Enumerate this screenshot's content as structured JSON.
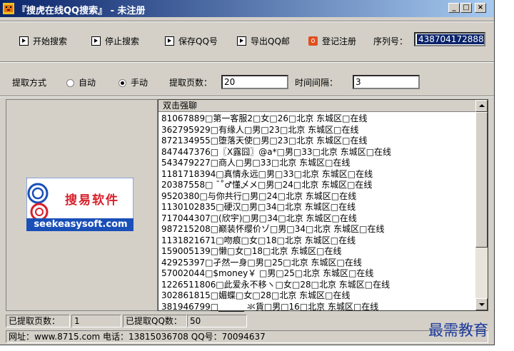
{
  "window": {
    "title": "『搜虎在线QQ搜索』 - 未注册",
    "controls": {
      "minimize": "_",
      "maximize": "□",
      "close": "×"
    }
  },
  "toolbar": {
    "start_search": "开始搜索",
    "stop_search": "停止搜索",
    "save_qq": "保存QQ号",
    "export_qq_mail": "导出QQ邮",
    "register": "登记注册",
    "serial_label": "序列号：",
    "serial_value": "438704172888"
  },
  "options": {
    "mode_label": "提取方式",
    "mode_auto": "自动",
    "mode_manual": "手动",
    "mode_selected": "manual",
    "pages_label": "提取页数：",
    "pages_value": "20",
    "interval_label": "时间间隔：",
    "interval_value": "3"
  },
  "logo": {
    "brand_cn": "搜易软件",
    "brand_url": "seekeasysoft.com"
  },
  "results": {
    "header": "双击强聊",
    "rows": [
      "81067889□第一客服2□女□26□北京 东城区□在线",
      "362795929□有缘人□男□23□北京 东城区□在线",
      "872134955□堕落天使□男□23□北京 东城区□在线",
      "847447376□〖Ⅹ露囧〗@a*□男□33□北京 东城区□在线",
      "543479227□商人□男□33□北京 东城区□在线",
      "1181718394□真情永远□男□33□北京 东城区□在线",
      "20387558□ ˉ˚♂懂乄メ□男□24□北京 东城区□在线",
      "9520380□与你共行□男□24□北京 东城区□在线",
      "1130102835□硬汉□男□34□北京 东城区□在线",
      "717044307□(欣宇)□男□34□北京 东城区□在线",
      "987215208□巅装怀缨价ゾ□男□34□北京 东城区□在线",
      "1131821671□吻痕□女□18□北京 东城区□在线",
      "159005139□懒□女□18□北京 东城区□在线",
      "42925397□孑然一身□男□25□北京 东城区□在线",
      "57002044□$money￥ □男□25□北京 东城区□在线",
      "1226511806□此爱永不移ヽ□女□28□北京 东城区□在线",
      "302861815□媚蝶□女□28□北京 东城区□在线",
      "381946799□______ 氺貨□男□16□北京 东城区□在线"
    ]
  },
  "status": {
    "pages_label": "已提取页数：",
    "pages_value": "1",
    "qq_label": "已提取QQ数：",
    "qq_value": "50",
    "footer": "网址：www.8715.com 电话：13815036708 QQ号：70094637"
  },
  "watermark": "最需教育",
  "colors": {
    "titlebar_start": "#0a246a",
    "titlebar_end": "#a6caf0",
    "window_bg": "#d4d0c8",
    "brand_red": "#d8202a",
    "brand_blue": "#1a4fb8",
    "watermark": "#1b3a9c"
  }
}
